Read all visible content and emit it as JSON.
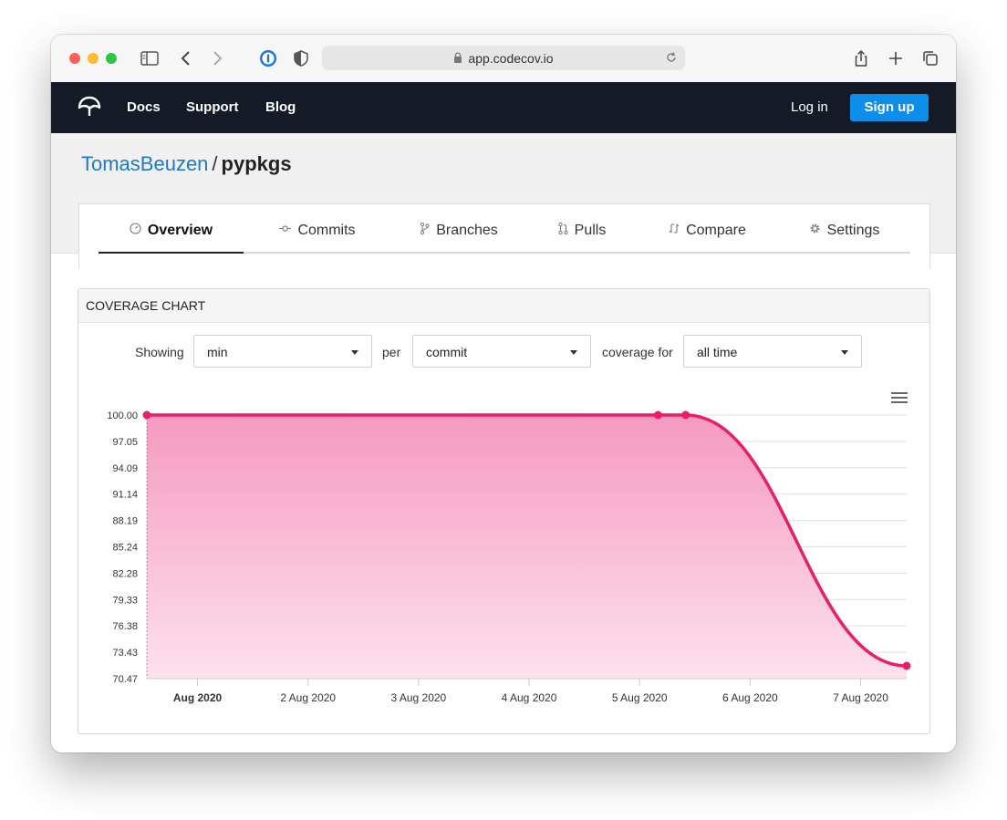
{
  "browser": {
    "url": "app.codecov.io"
  },
  "nav": {
    "links": [
      "Docs",
      "Support",
      "Blog"
    ],
    "login": "Log in",
    "signup": "Sign up"
  },
  "repo": {
    "owner": "TomasBeuzen",
    "separator": "/",
    "name": "pypkgs"
  },
  "tabs": [
    {
      "label": "Overview",
      "icon": "gauge-icon",
      "active": true
    },
    {
      "label": "Commits",
      "icon": "commit-icon",
      "active": false
    },
    {
      "label": "Branches",
      "icon": "branch-icon",
      "active": false
    },
    {
      "label": "Pulls",
      "icon": "pull-request-icon",
      "active": false
    },
    {
      "label": "Compare",
      "icon": "compare-icon",
      "active": false
    },
    {
      "label": "Settings",
      "icon": "gear-icon",
      "active": false
    }
  ],
  "panel": {
    "title": "COVERAGE CHART",
    "showing_label": "Showing",
    "showing_value": "min",
    "per_label": "per",
    "per_value": "commit",
    "coverage_for_label": "coverage for",
    "coverage_for_value": "all time"
  },
  "chart_data": {
    "type": "area",
    "y_ticks": [
      "100.00",
      "97.05",
      "94.09",
      "91.14",
      "88.19",
      "85.24",
      "82.28",
      "79.33",
      "76.38",
      "73.43",
      "70.47"
    ],
    "x_ticks": [
      "Aug 2020",
      "2 Aug 2020",
      "3 Aug 2020",
      "4 Aug 2020",
      "5 Aug 2020",
      "6 Aug 2020",
      "7 Aug 2020"
    ],
    "ylim": [
      70.47,
      100.0
    ],
    "xlim": [
      "2020-07-31T13:00",
      "2020-08-07T10:00"
    ],
    "x_tick_dates": [
      "2020-08-01",
      "2020-08-02",
      "2020-08-03",
      "2020-08-04",
      "2020-08-05",
      "2020-08-06",
      "2020-08-07"
    ],
    "points": [
      {
        "x": "2020-07-31T13:00",
        "y": 100.0
      },
      {
        "x": "2020-08-05T04:00",
        "y": 100.0
      },
      {
        "x": "2020-08-05T10:00",
        "y": 100.0
      },
      {
        "x": "2020-08-07T10:00",
        "y": 71.9
      }
    ],
    "grid": true,
    "line_color": "#e91e6b",
    "fill_top_color": "#f59ac0",
    "fill_bottom_color": "#fde1ec"
  }
}
